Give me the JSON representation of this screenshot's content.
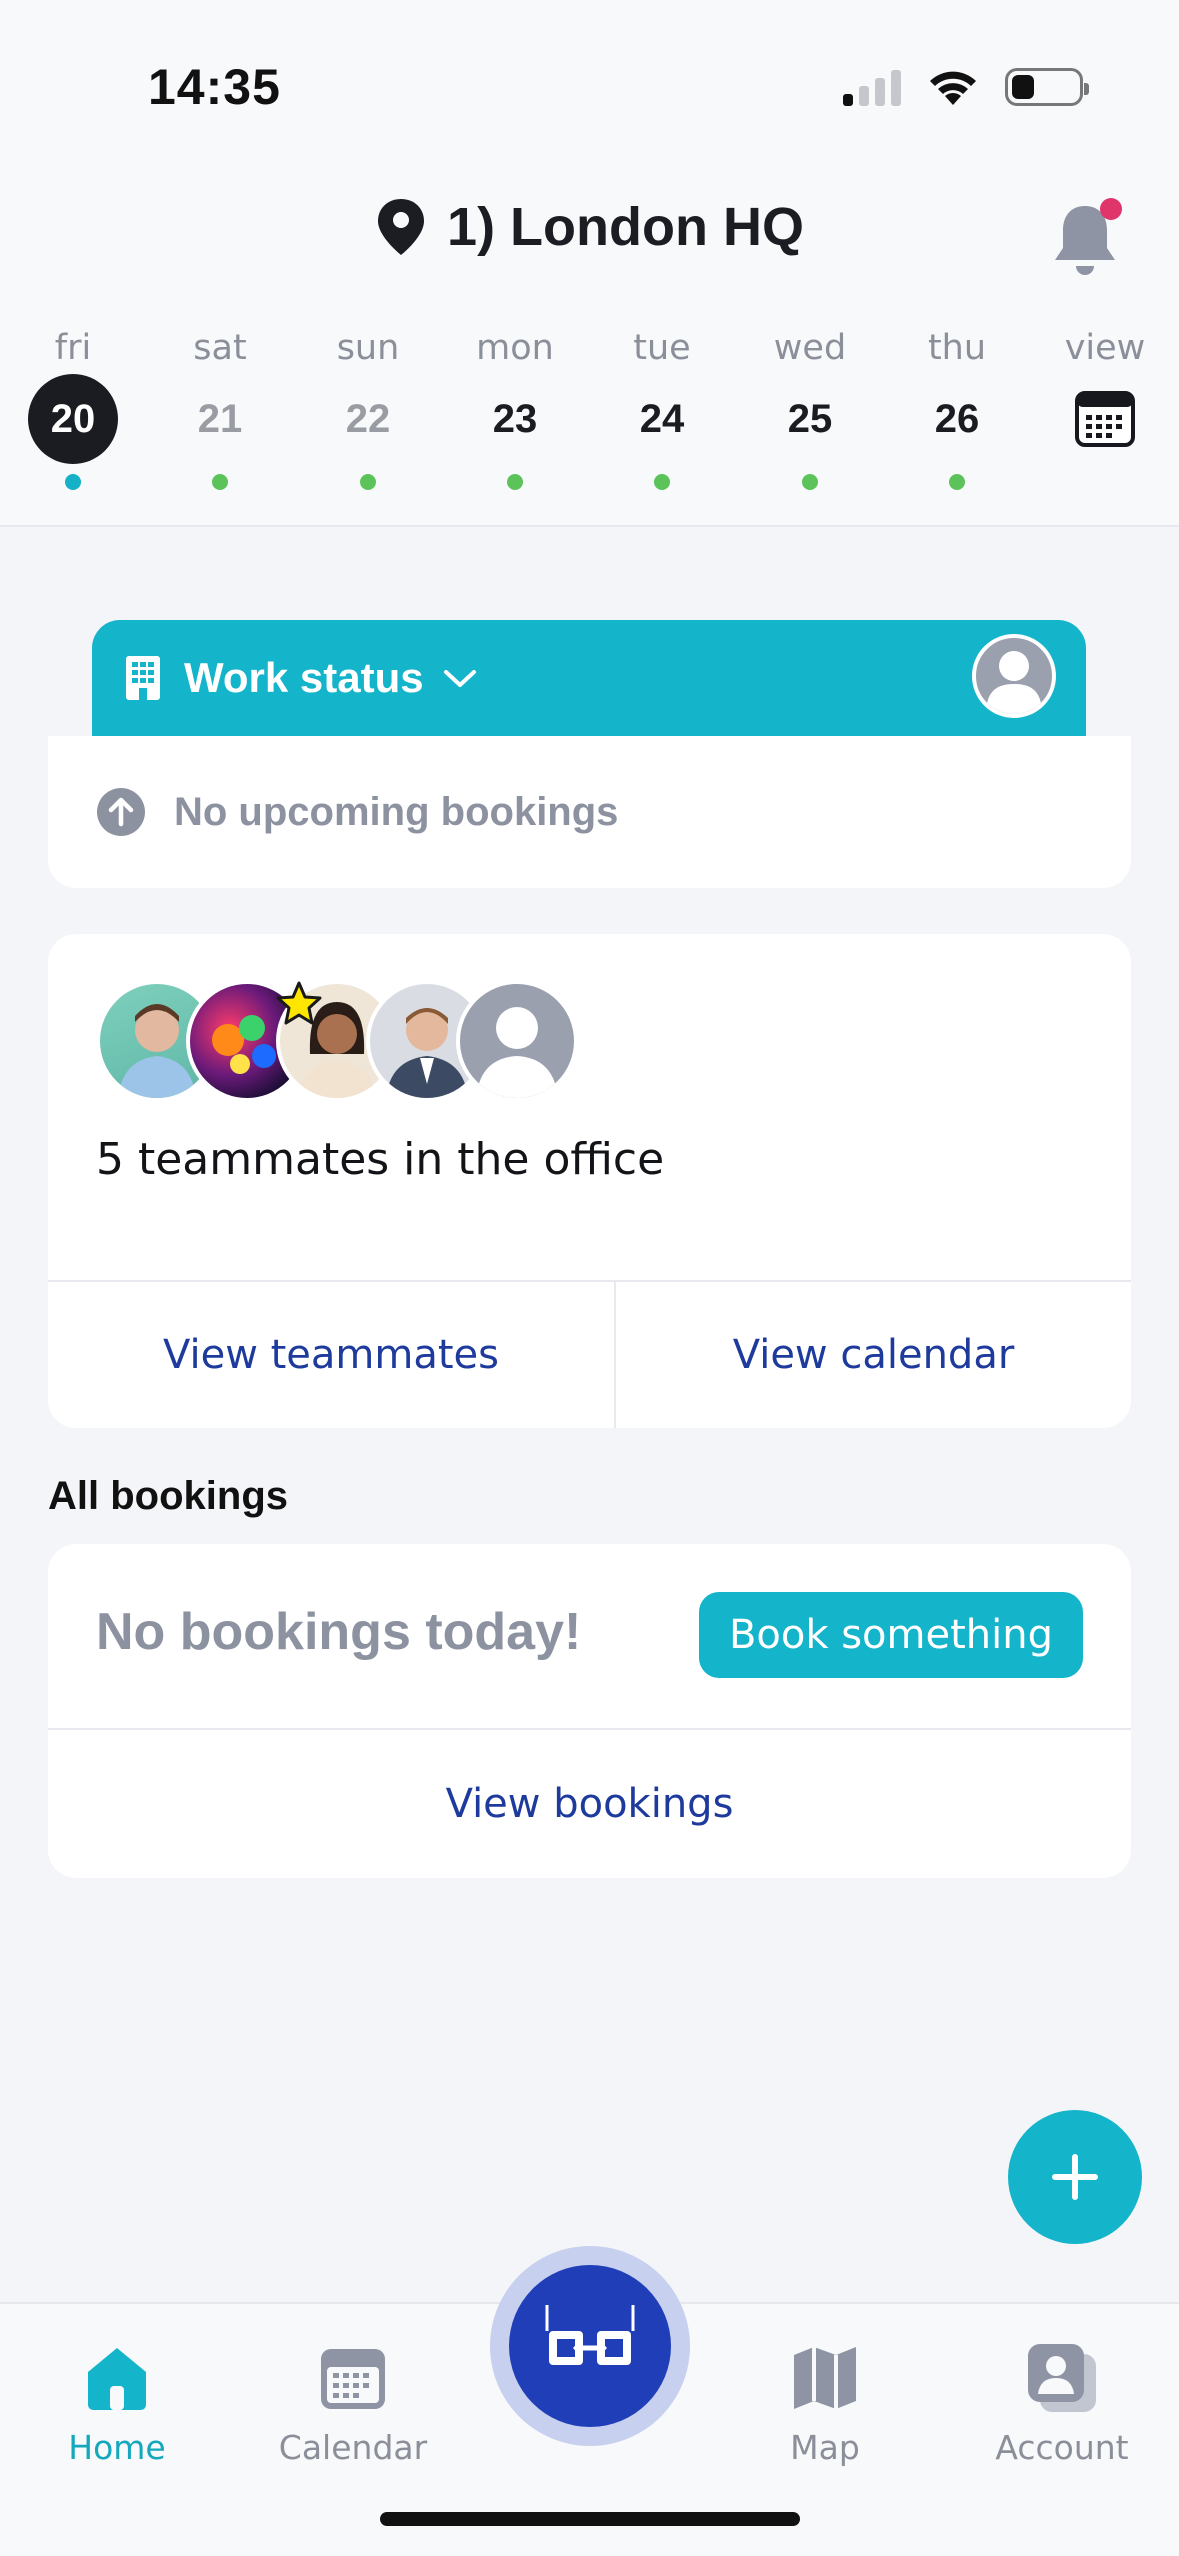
{
  "status_bar": {
    "time": "14:35"
  },
  "header": {
    "location": "1) London HQ"
  },
  "days": [
    {
      "name": "fri",
      "num": "20",
      "state": "selected",
      "dot": "teal"
    },
    {
      "name": "sat",
      "num": "21",
      "state": "muted",
      "dot": "green"
    },
    {
      "name": "sun",
      "num": "22",
      "state": "muted",
      "dot": "green"
    },
    {
      "name": "mon",
      "num": "23",
      "state": "normal",
      "dot": "green"
    },
    {
      "name": "tue",
      "num": "24",
      "state": "normal",
      "dot": "green"
    },
    {
      "name": "wed",
      "num": "25",
      "state": "normal",
      "dot": "green"
    },
    {
      "name": "thu",
      "num": "26",
      "state": "normal",
      "dot": "green"
    }
  ],
  "view_label": "view",
  "work_status": {
    "title": "Work status",
    "upcoming": "No upcoming bookings"
  },
  "team": {
    "summary": "5 teammates in the office",
    "view_teammates": "View teammates",
    "view_calendar": "View calendar"
  },
  "bookings": {
    "section_title": "All bookings",
    "empty": "No bookings today!",
    "book_button": "Book something",
    "view_bookings": "View bookings"
  },
  "tabs": {
    "home": "Home",
    "calendar": "Calendar",
    "map": "Map",
    "account": "Account"
  },
  "colors": {
    "accent": "#14b4cb",
    "primary": "#1f3eb8",
    "link": "#1d3a9c",
    "notification": "#e0356b"
  }
}
